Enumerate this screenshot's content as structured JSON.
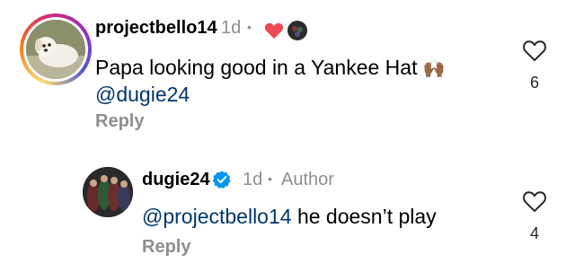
{
  "comment": {
    "username": "projectbello14",
    "time": "1d",
    "separator": "•",
    "text": "Papa looking good in a Yankee Hat",
    "mention": "@dugie24",
    "reply_label": "Reply",
    "like_count": "6",
    "emoji": "🙌🏾",
    "liked_by_author_icon": "red-heart-icon"
  },
  "reply": {
    "username": "dugie24",
    "time": "1d",
    "separator": "•",
    "author_badge": "Author",
    "mention": "@projectbello14",
    "text": "he doesn’t play",
    "reply_label": "Reply",
    "like_count": "4",
    "verified_icon": "verified-badge-icon"
  },
  "colors": {
    "mention": "#00376b",
    "secondary": "#8e8e8e",
    "heart": "#ed4956",
    "verified": "#0095f6"
  }
}
